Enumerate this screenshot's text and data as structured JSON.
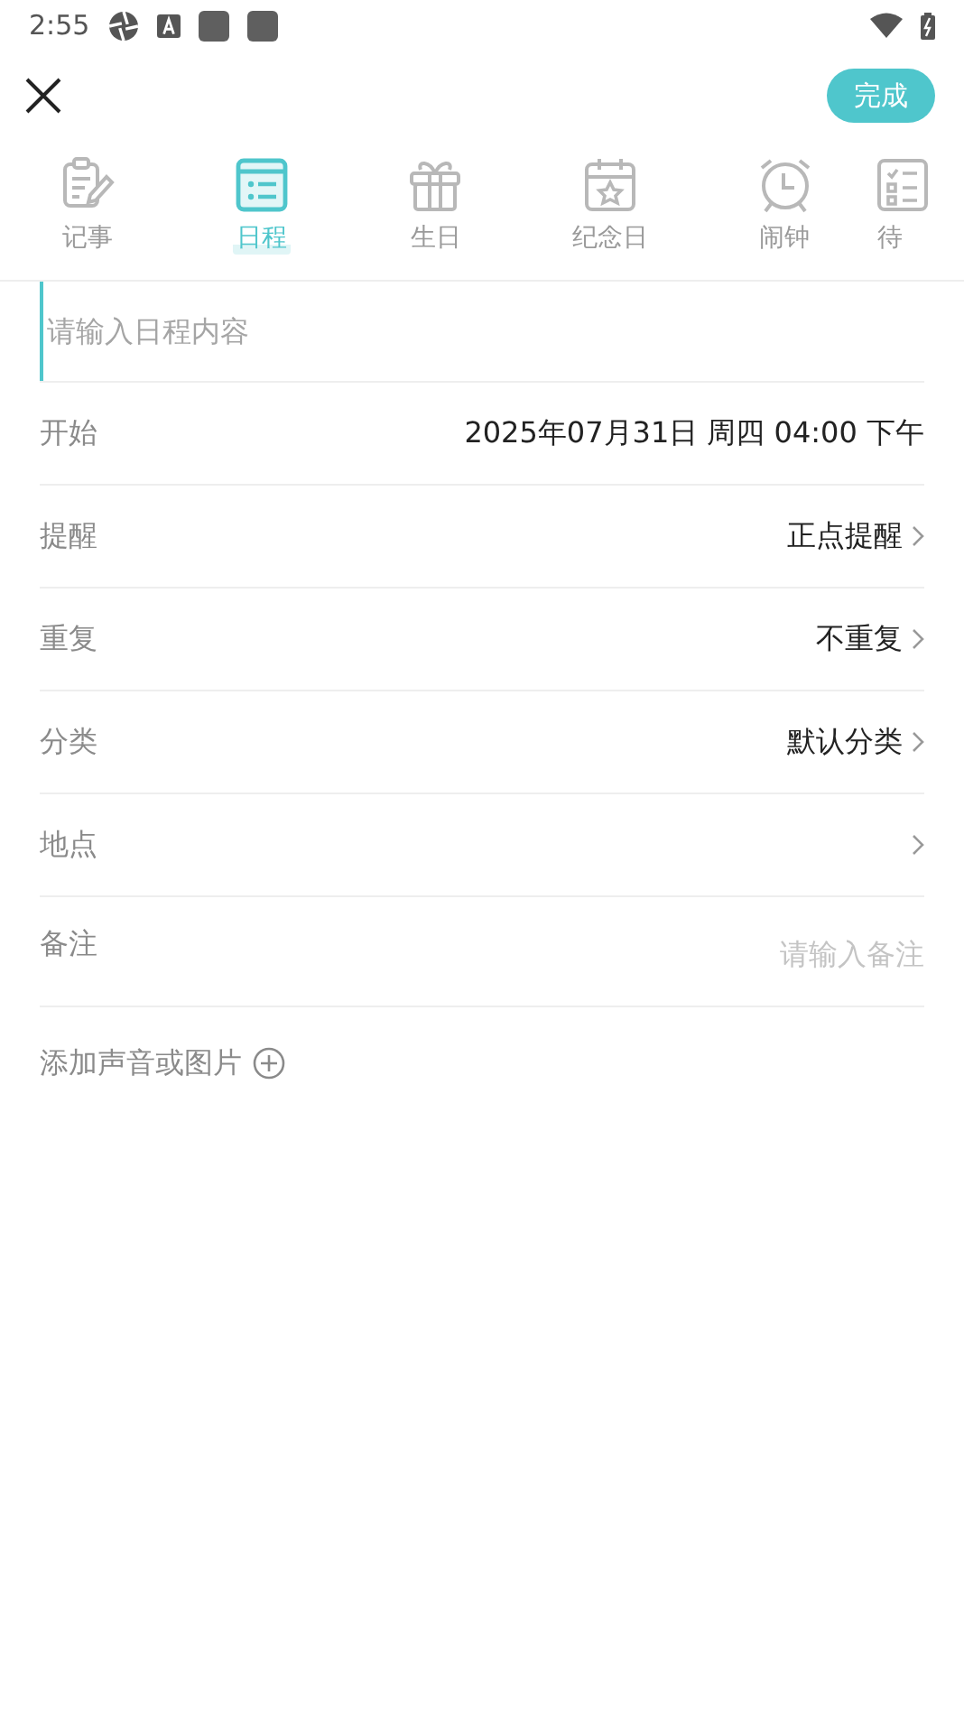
{
  "status_bar": {
    "time": "2:55"
  },
  "header": {
    "done_button": "完成"
  },
  "tabs": [
    {
      "label": "记事",
      "selected": false
    },
    {
      "label": "日程",
      "selected": true
    },
    {
      "label": "生日",
      "selected": false
    },
    {
      "label": "纪念日",
      "selected": false
    },
    {
      "label": "闹钟",
      "selected": false
    },
    {
      "label": "待",
      "selected": false
    }
  ],
  "title_field": {
    "placeholder": "请输入日程内容"
  },
  "rows": [
    {
      "kind": "plain",
      "label": "开始",
      "value": "2025年07月31日 周四 04:00 下午"
    },
    {
      "kind": "select",
      "label": "提醒",
      "value": "正点提醒"
    },
    {
      "kind": "select",
      "label": "重复",
      "value": "不重复"
    },
    {
      "kind": "select",
      "label": "分类",
      "value": "默认分类"
    },
    {
      "kind": "select",
      "label": "地点"
    },
    {
      "kind": "input",
      "label": "备注",
      "placeholder": "请输入备注"
    }
  ],
  "add_media": {
    "label": "添加声音或图片"
  }
}
